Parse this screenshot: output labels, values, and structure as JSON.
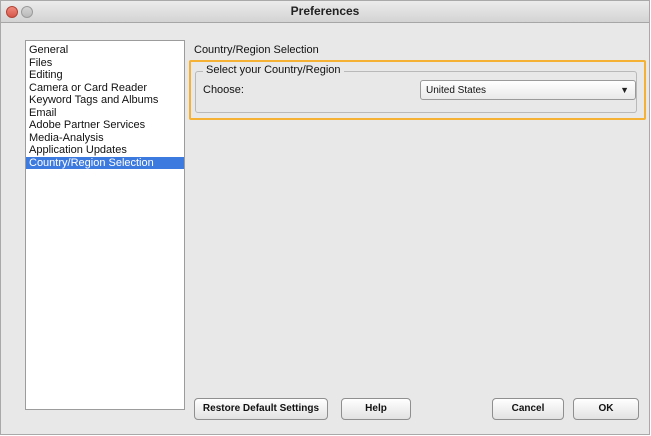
{
  "window": {
    "title": "Preferences"
  },
  "sidebar": {
    "items": [
      {
        "label": "General"
      },
      {
        "label": "Files"
      },
      {
        "label": "Editing"
      },
      {
        "label": "Camera or Card Reader"
      },
      {
        "label": "Keyword Tags and Albums"
      },
      {
        "label": "Email"
      },
      {
        "label": "Adobe Partner Services"
      },
      {
        "label": "Media-Analysis"
      },
      {
        "label": "Application Updates"
      },
      {
        "label": "Country/Region Selection",
        "selected": true
      }
    ]
  },
  "main": {
    "panel_title": "Country/Region Selection",
    "group": {
      "legend": "Select your Country/Region",
      "choose_label": "Choose:",
      "country_select": {
        "value": "United States"
      }
    }
  },
  "footer": {
    "restore_label": "Restore Default Settings",
    "help_label": "Help",
    "cancel_label": "Cancel",
    "ok_label": "OK"
  },
  "colors": {
    "selection": "#3d7ae0",
    "highlight_outline": "#f5b133"
  },
  "icons": {
    "dropdown": "chevron-down-icon"
  }
}
